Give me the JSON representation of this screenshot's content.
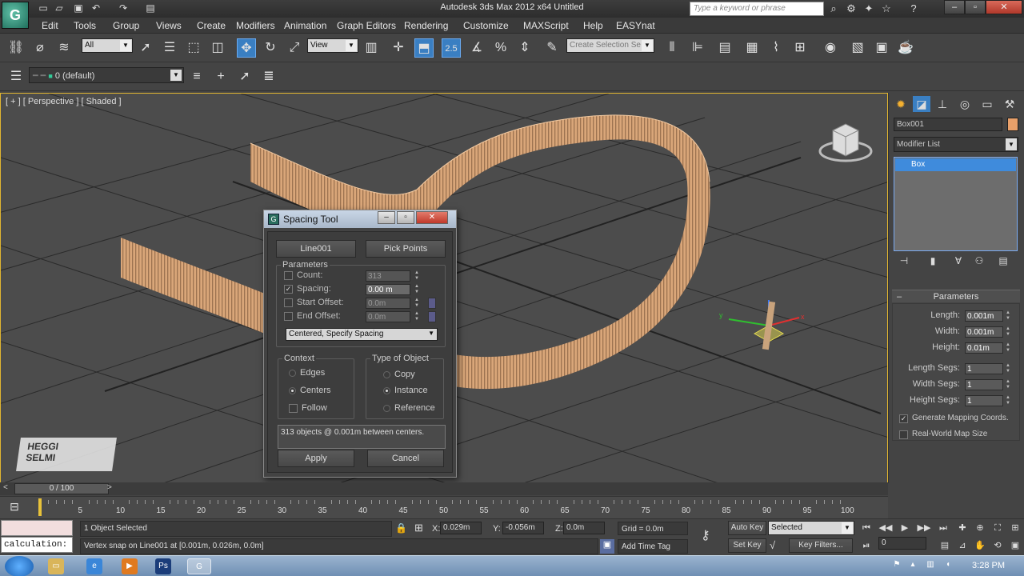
{
  "window": {
    "title": "Autodesk 3ds Max  2012 x64      Untitled",
    "search_placeholder": "Type a keyword or phrase"
  },
  "menu": [
    "Edit",
    "Tools",
    "Group",
    "Views",
    "Create",
    "Modifiers",
    "Animation",
    "Graph Editors",
    "Rendering",
    "Customize",
    "MAXScript",
    "Help",
    "EASYnat"
  ],
  "toolbar": {
    "selection_filter": "All",
    "ref_coord": "View",
    "snap_value": "2.5",
    "selection_set_placeholder": "Create Selection Se",
    "layer": "0 (default)"
  },
  "viewport": {
    "label": "[ + ] [ Perspective ] [ Shaded ]",
    "watermark_line1": "HEGGI",
    "watermark_line2": "SELMI"
  },
  "spacing_tool": {
    "title": "Spacing Tool",
    "path_button": "Line001",
    "pick_points_button": "Pick Points",
    "parameters_title": "Parameters",
    "count_label": "Count:",
    "count_value": "313",
    "count_checked": false,
    "spacing_label": "Spacing:",
    "spacing_value": "0.00 m",
    "spacing_checked": true,
    "start_offset_label": "Start Offset:",
    "start_offset_value": "0.0m",
    "start_offset_checked": false,
    "end_offset_label": "End Offset:",
    "end_offset_value": "0.0m",
    "end_offset_checked": false,
    "distribution": "Centered, Specify Spacing",
    "context_title": "Context",
    "context_options": [
      "Edges",
      "Centers"
    ],
    "context_selected": "Centers",
    "follow_label": "Follow",
    "type_title": "Type of Object",
    "type_options": [
      "Copy",
      "Instance",
      "Reference"
    ],
    "type_selected": "Instance",
    "status": "313 objects @ 0.001m  between centers.",
    "apply_button": "Apply",
    "cancel_button": "Cancel"
  },
  "command_panel": {
    "object_name": "Box001",
    "object_color": "#e8a06a",
    "modifier_list": "Modifier List",
    "stack_item": "Box",
    "parameters_title": "Parameters",
    "length_label": "Length:",
    "length_value": "0.001m",
    "width_label": "Width:",
    "width_value": "0.001m",
    "height_label": "Height:",
    "height_value": "0.01m",
    "length_segs_label": "Length Segs:",
    "length_segs_value": "1",
    "width_segs_label": "Width Segs:",
    "width_segs_value": "1",
    "height_segs_label": "Height Segs:",
    "height_segs_value": "1",
    "gen_mapping_label": "Generate Mapping Coords.",
    "gen_mapping_checked": true,
    "real_world_label": "Real-World Map Size",
    "real_world_checked": false
  },
  "timeline": {
    "frame_display": "0 / 100",
    "ticks": [
      "0",
      "5",
      "10",
      "15",
      "20",
      "25",
      "30",
      "35",
      "40",
      "45",
      "50",
      "55",
      "60",
      "65",
      "70",
      "75",
      "80",
      "85",
      "90",
      "95",
      "100"
    ]
  },
  "status": {
    "listener_input": "calculation:",
    "selection_status": "1 Object Selected",
    "prompt": "Vertex snap on Line001 at [0.001m, 0.026m, 0.0m]",
    "x_label": "X:",
    "x_value": "0.029m",
    "y_label": "Y:",
    "y_value": "-0.056m",
    "z_label": "Z:",
    "z_value": "0.0m",
    "grid": "Grid = 0.0m",
    "add_time_tag": "Add Time Tag",
    "auto_key": "Auto Key",
    "set_key": "Set Key",
    "key_mode": "Selected",
    "key_filters": "Key Filters...",
    "current_frame": "0"
  },
  "taskbar": {
    "time": "3:28 PM"
  }
}
